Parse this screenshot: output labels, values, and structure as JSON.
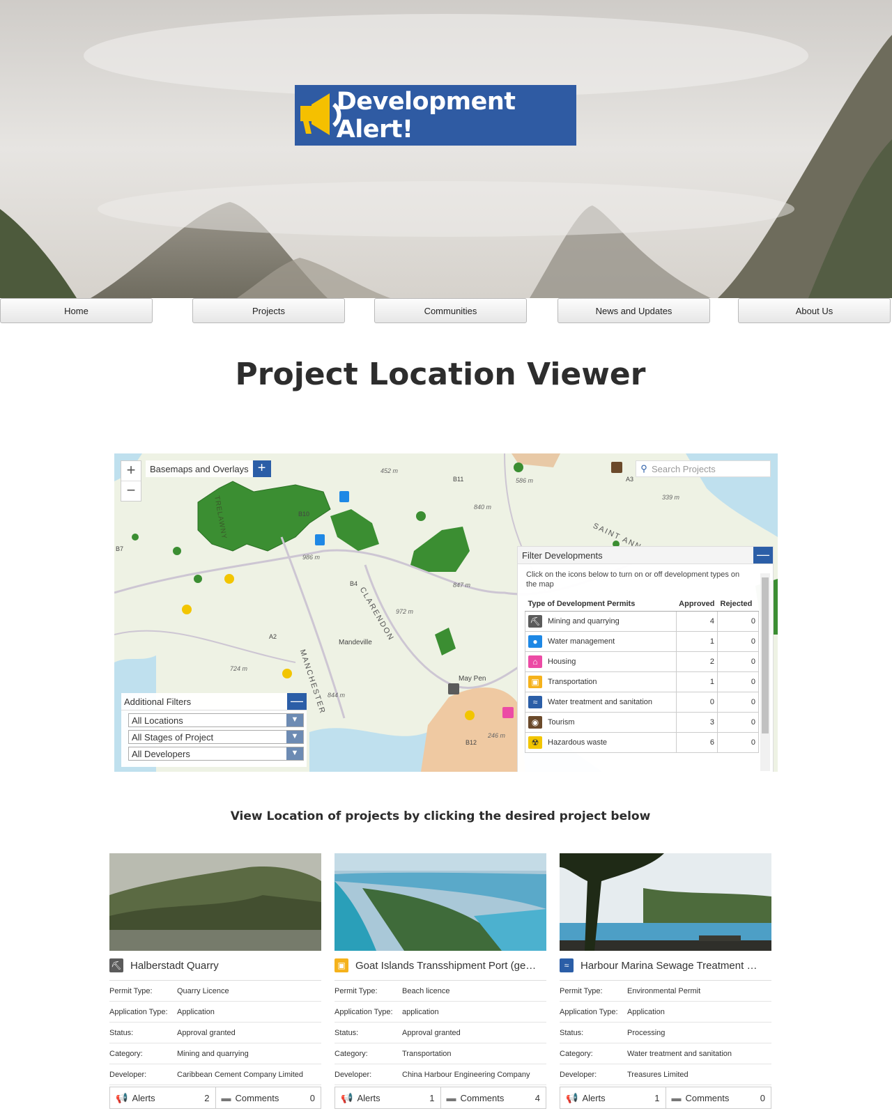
{
  "header": {
    "logo_text": "Development Alert!"
  },
  "nav": {
    "items": [
      "Home",
      "Projects",
      "Communities",
      "News and Updates",
      "About Us"
    ]
  },
  "page_title": "Project Location Viewer",
  "map": {
    "basemaps_label": "Basemaps and Overlays",
    "search_placeholder": "Search Projects",
    "place_labels": [
      "Mandeville",
      "May Pen",
      "CLARENDON",
      "MANCHESTER",
      "TRELAWNY",
      "SAINT ANN"
    ],
    "road_labels": [
      "B11",
      "B10",
      "B4",
      "A2",
      "A3",
      "B12",
      "B7"
    ],
    "elevations": [
      "452 m",
      "586 m",
      "840 m",
      "339 m",
      "986 m",
      "847 m",
      "972 m",
      "724 m",
      "844 m",
      "246 m"
    ],
    "filter_developments": {
      "title": "Filter Developments",
      "intro": "Click on the icons below to turn on or off development types on the map",
      "headers": [
        "Type of Development Permits",
        "Approved",
        "Rejected"
      ],
      "rows": [
        {
          "name": "Mining and quarrying",
          "approved": "4",
          "rejected": "0",
          "icon": "pickaxe-icon",
          "color": "#5b5b5b"
        },
        {
          "name": "Water management",
          "approved": "1",
          "rejected": "0",
          "icon": "water-drop-icon",
          "color": "#1e88e5"
        },
        {
          "name": "Housing",
          "approved": "2",
          "rejected": "0",
          "icon": "house-icon",
          "color": "#ec4ba5"
        },
        {
          "name": "Transportation",
          "approved": "1",
          "rejected": "0",
          "icon": "bus-icon",
          "color": "#f5b21b"
        },
        {
          "name": "Water treatment and sanitation",
          "approved": "0",
          "rejected": "0",
          "icon": "waves-icon",
          "color": "#2b5ea7"
        },
        {
          "name": "Tourism",
          "approved": "3",
          "rejected": "0",
          "icon": "camera-icon",
          "color": "#6b4a2b"
        },
        {
          "name": "Hazardous waste",
          "approved": "6",
          "rejected": "0",
          "icon": "radiation-icon",
          "color": "#f2c500"
        }
      ]
    },
    "additional_filters": {
      "title": "Additional Filters",
      "locations": "All Locations",
      "stages": "All Stages of Project",
      "developers": "All Developers"
    }
  },
  "projects_subtitle": "View Location of projects by clicking the desired project below",
  "labels": {
    "permit": "Permit Type:",
    "app": "Application Type:",
    "status": "Status:",
    "category": "Category:",
    "developer": "Developer:",
    "alerts": "Alerts",
    "comments": "Comments"
  },
  "projects": [
    {
      "title": "Halberstadt Quarry",
      "icon": "pickaxe-icon",
      "color": "#5b5b5b",
      "permit": "Quarry Licence",
      "app": "Application",
      "status": "Approval granted",
      "category": "Mining and quarrying",
      "developer": "Caribbean Cement Company Limited",
      "alerts": "2",
      "comments": "0"
    },
    {
      "title": "Goat Islands Transshipment Port (ge…",
      "icon": "bus-icon",
      "color": "#f5b21b",
      "permit": "Beach licence",
      "app": "application",
      "status": "Approval granted",
      "category": "Transportation",
      "developer": "China Harbour Engineering Company",
      "alerts": "1",
      "comments": "4"
    },
    {
      "title": "Harbour Marina Sewage Treatment …",
      "icon": "waves-icon",
      "color": "#2b5ea7",
      "permit": "Environmental Permit",
      "app": "Application",
      "status": "Processing",
      "category": "Water treatment and sanitation",
      "developer": "Treasures Limited",
      "alerts": "1",
      "comments": "0"
    }
  ]
}
